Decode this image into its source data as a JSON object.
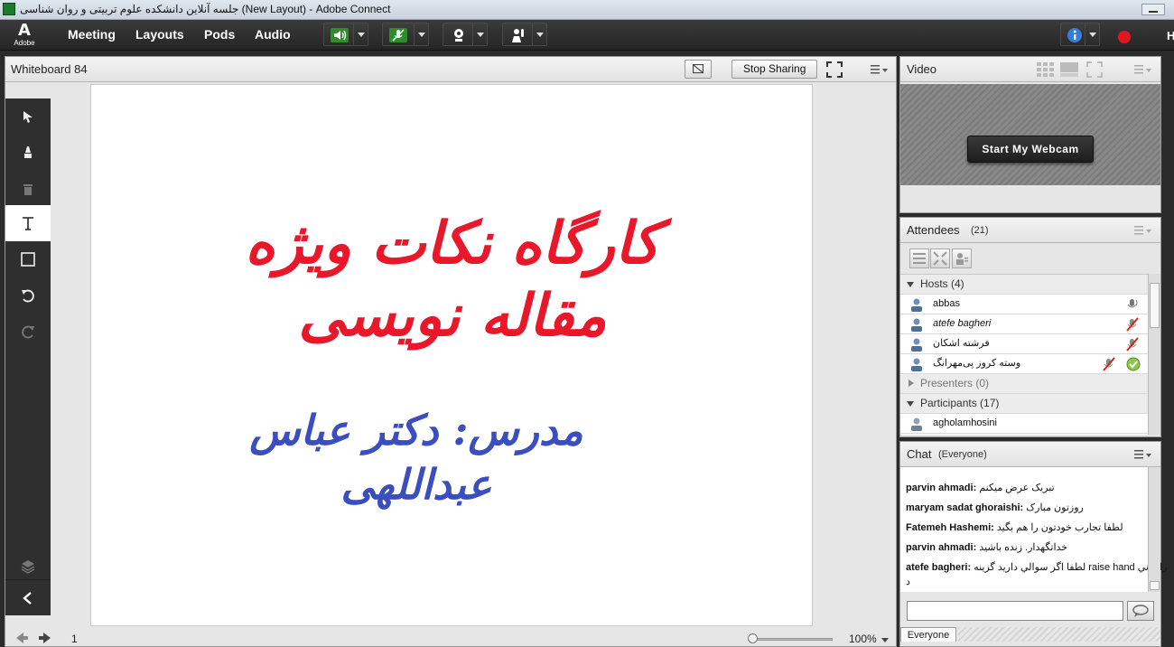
{
  "window": {
    "title": "جلسه آنلاین دانشکده علوم تربیتی و روان شناسی (New Layout) - Adobe Connect"
  },
  "menubar": {
    "logo_text": "A",
    "logo_word": "Adobe",
    "items": [
      "Meeting",
      "Layouts",
      "Pods",
      "Audio"
    ],
    "cutoff_label": "H"
  },
  "whiteboard": {
    "title": "Whiteboard 84",
    "stop_sharing_label": "Stop Sharing",
    "content": {
      "heading": "کارگاه نکات ویژه مقاله نویسی",
      "subheading": "مدرس: دکتر عباس عبداللهی"
    },
    "footer": {
      "page_number": "1",
      "zoom": "100%",
      "zoom_fraction": 0.0
    }
  },
  "video": {
    "title": "Video",
    "start_webcam_label": "Start My Webcam"
  },
  "attendees": {
    "title": "Attendees",
    "count": "(21)",
    "hosts_label": "Hosts (4)",
    "hosts": [
      {
        "name": "abbas",
        "italic": false
      },
      {
        "name": "atefe bagheri",
        "italic": true
      },
      {
        "name": "فرشته اشکان",
        "italic": false
      },
      {
        "name": "وسته کروز پی‌مهرانگ",
        "italic": false
      }
    ],
    "presenters_label": "Presenters (0)",
    "participants_label": "Participants (17)",
    "participants": [
      {
        "name": "agholamhosini"
      }
    ]
  },
  "chat": {
    "title": "Chat",
    "scope": "(Everyone)",
    "tab_label": "Everyone",
    "messages": [
      {
        "sender": "parvin ahmadi:",
        "text": "تبریک عرض میکنم"
      },
      {
        "sender": "maryam sadat ghoraishi:",
        "text": "روزتون مبارک"
      },
      {
        "sender": "Fatemeh Hashemi:",
        "text": "لطفا تجارب خودتون را هم بگید"
      },
      {
        "sender": "parvin ahmadi:",
        "text": "خداتگهدار. زنده باشید"
      },
      {
        "sender": "atefe bagheri:",
        "text": "لطفا اگر سوالي داريد گزينه raise hand را بزني",
        "wrap": "د"
      }
    ]
  },
  "colors": {
    "heading": "#e8182a",
    "subheading": "#3a4ec0",
    "record": "#e0181e"
  }
}
